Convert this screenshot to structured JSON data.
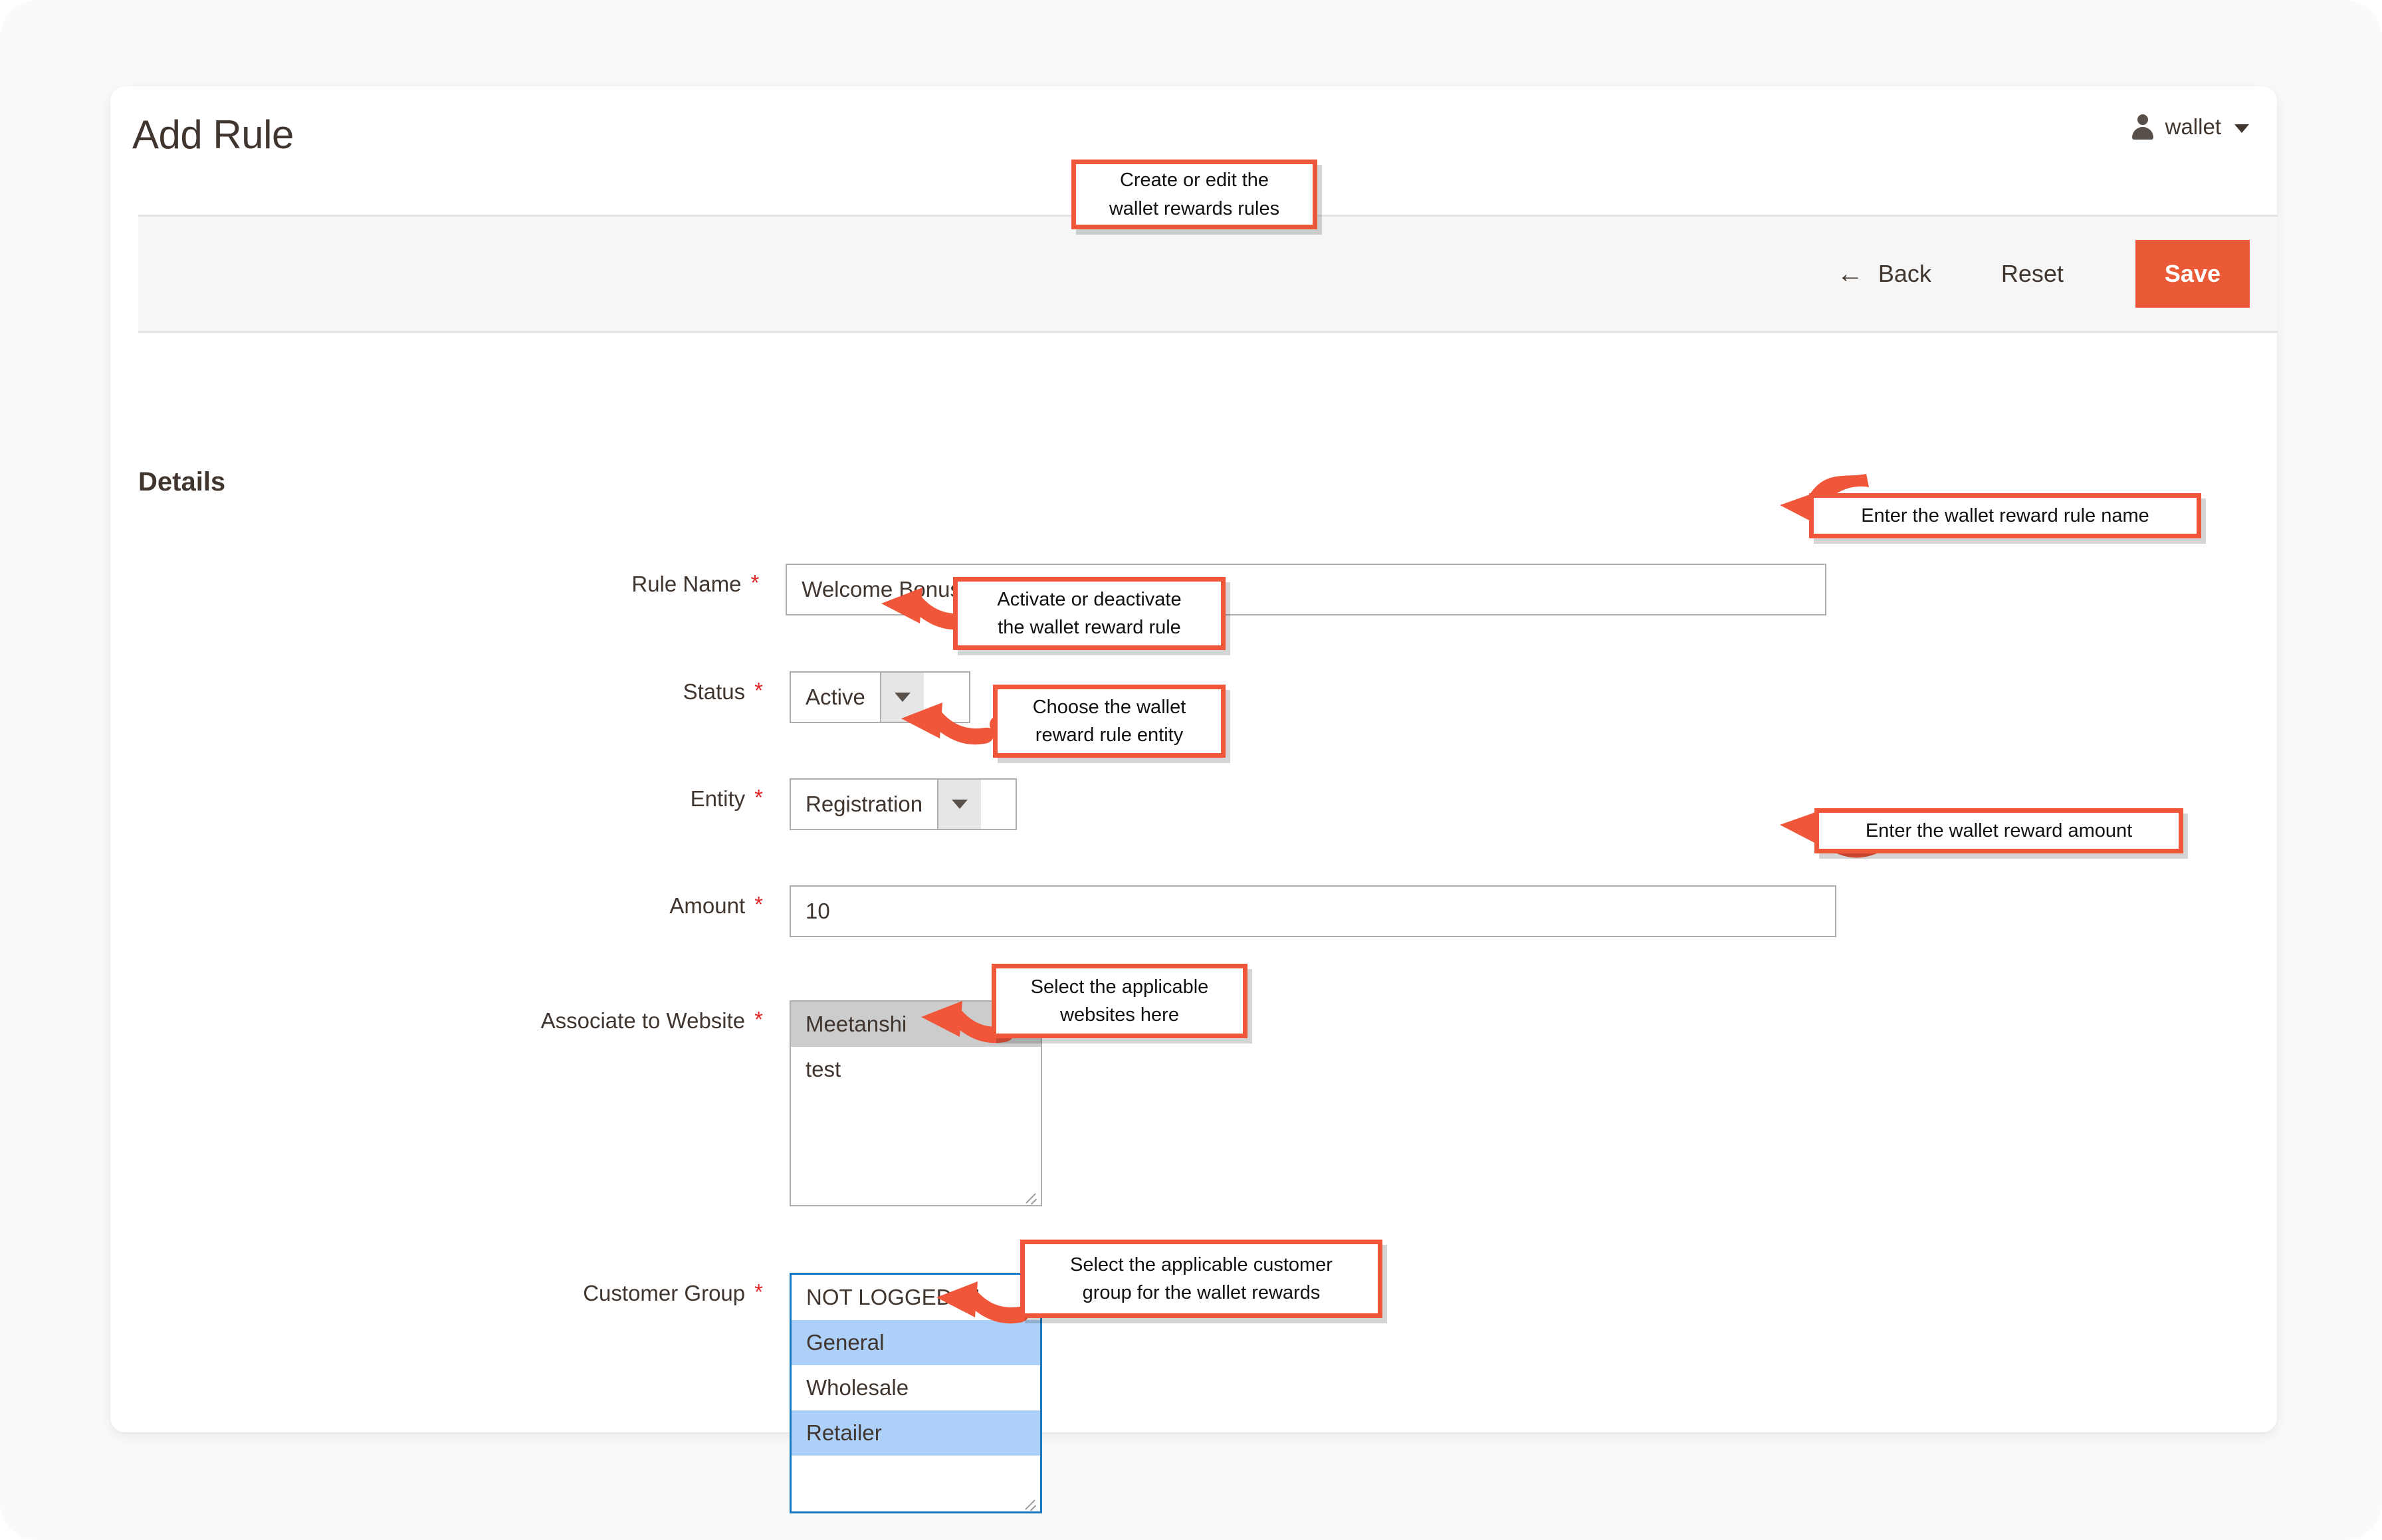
{
  "header": {
    "page_title": "Add Rule",
    "user_name": "wallet",
    "user_icon": "user-avatar-icon",
    "caret_icon": "chevron-down-icon"
  },
  "toolbar": {
    "back_label": "Back",
    "back_icon": "arrow-left-icon",
    "reset_label": "Reset",
    "save_label": "Save",
    "save_color": "#eb5a37"
  },
  "form": {
    "section_title": "Details",
    "required_marker": "*",
    "fields": {
      "rule_name": {
        "label": "Rule Name",
        "value": "Welcome Bonus"
      },
      "status": {
        "label": "Status",
        "value": "Active",
        "arrow_icon": "caret-down-icon"
      },
      "entity": {
        "label": "Entity",
        "value": "Registration",
        "arrow_icon": "caret-down-icon"
      },
      "amount": {
        "label": "Amount",
        "value": "10"
      },
      "associate_to_website": {
        "label": "Associate to Website",
        "options": [
          {
            "label": "Meetanshi",
            "selected": true
          },
          {
            "label": "test",
            "selected": false
          }
        ]
      },
      "customer_group": {
        "label": "Customer Group",
        "options": [
          {
            "label": "NOT LOGGED IN",
            "selected": false
          },
          {
            "label": "General",
            "selected": true
          },
          {
            "label": "Wholesale",
            "selected": false
          },
          {
            "label": "Retailer",
            "selected": true
          }
        ]
      }
    }
  },
  "annotations": {
    "accent_color": "#f0563a",
    "items": [
      {
        "id": "header-note",
        "line1": "Create or edit the",
        "line2": "wallet rewards rules"
      },
      {
        "id": "rule-name-note",
        "line1": "Enter the wallet reward rule name",
        "line2": ""
      },
      {
        "id": "status-note",
        "line1": "Activate or deactivate",
        "line2": "the wallet reward rule"
      },
      {
        "id": "entity-note",
        "line1": "Choose the wallet",
        "line2": "reward rule entity"
      },
      {
        "id": "amount-note",
        "line1": "Enter the wallet reward amount",
        "line2": ""
      },
      {
        "id": "website-note",
        "line1": "Select the applicable",
        "line2": "websites here"
      },
      {
        "id": "customer-group-note",
        "line1": "Select the applicable customer",
        "line2": "group for the wallet rewards"
      }
    ]
  }
}
